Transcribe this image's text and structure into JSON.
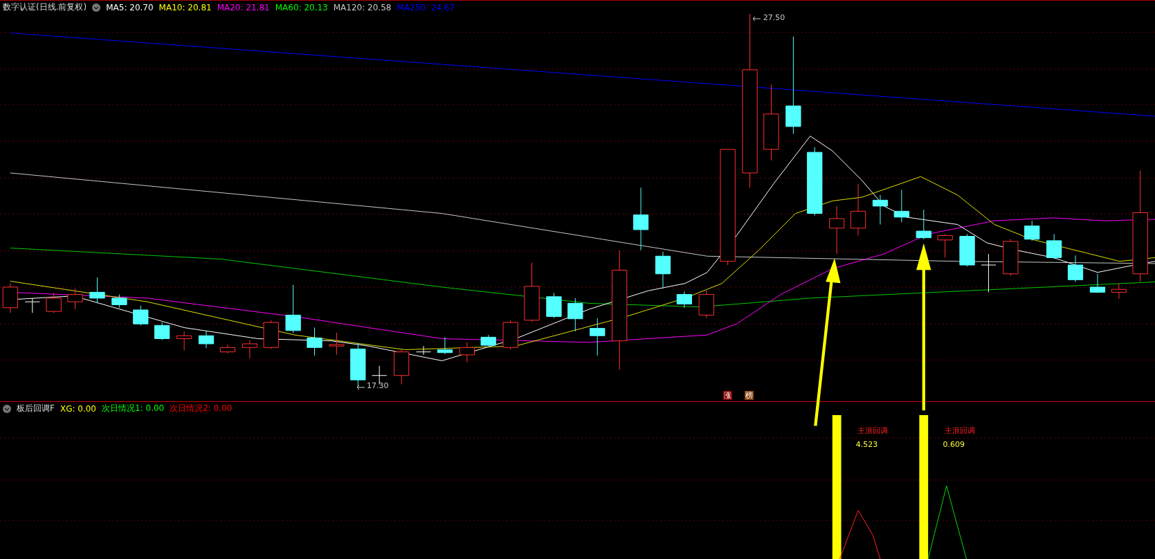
{
  "main_pane": {
    "title": "数字认证(日线.前复权)",
    "indicators": [
      {
        "label": "MA5: 20.70",
        "color": "#ffffff"
      },
      {
        "label": "MA10: 20.81",
        "color": "#ffff00"
      },
      {
        "label": "MA20: 21.81",
        "color": "#ff00ff"
      },
      {
        "label": "MA60: 20.13",
        "color": "#00ff00"
      },
      {
        "label": "MA120: 20.58",
        "color": "#c8c8c8"
      },
      {
        "label": "MA250: 24.67",
        "color": "#0000ff"
      }
    ],
    "high_label": "27.50",
    "low_label": "17.30",
    "badges": [
      {
        "text": "涨",
        "color": "#8b0000"
      },
      {
        "text": "榜",
        "color": "#8b4513"
      }
    ]
  },
  "sub_pane": {
    "title": "板后回调F",
    "indicators": [
      {
        "label": "XG: 0.00",
        "color": "#ffff00"
      },
      {
        "label": "次日情况1: 0.00",
        "color": "#00ff00"
      },
      {
        "label": "次日情况2: 0.00",
        "color": "#ff0000"
      }
    ],
    "signals": [
      {
        "label": "主浪回调",
        "value": "4.523"
      },
      {
        "label": "主浪回调",
        "value": "0.609"
      }
    ]
  }
}
